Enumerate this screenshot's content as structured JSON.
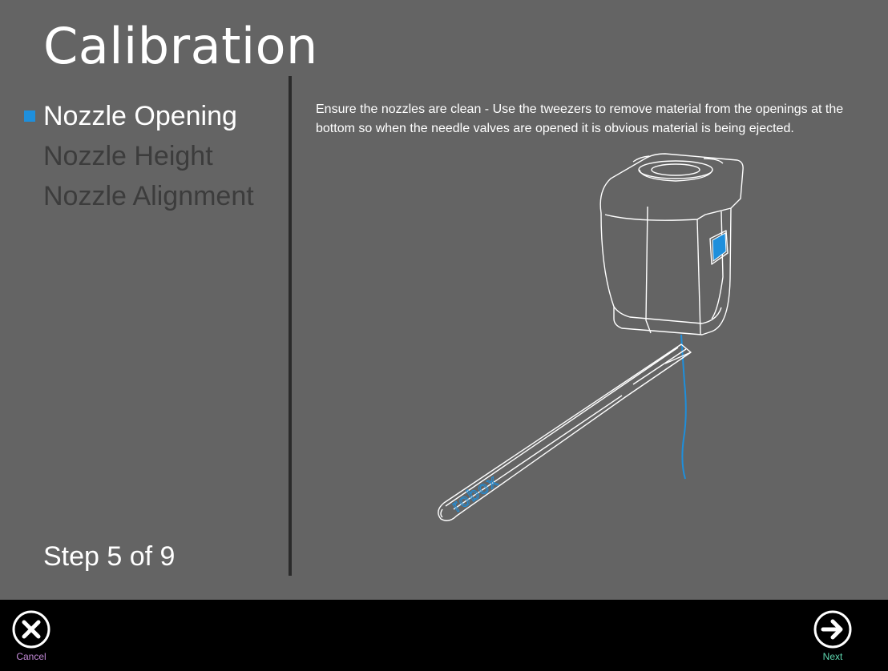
{
  "header": {
    "title": "Calibration"
  },
  "steps": [
    {
      "label": "Nozzle Opening",
      "active": true
    },
    {
      "label": "Nozzle Height",
      "active": false
    },
    {
      "label": "Nozzle Alignment",
      "active": false
    }
  ],
  "step_counter": "Step 5 of 9",
  "instructions": "Ensure the nozzles are clean - Use the tweezers to remove material from the openings at the bottom so when the needle valves are opened it is obvious material is being ejected.",
  "illustration": {
    "tweezers_brand": "robox",
    "icons": [
      "print-head-icon",
      "tweezers-icon",
      "filament-strand-icon"
    ]
  },
  "footer": {
    "cancel_label": "Cancel",
    "cancel_icon": "close-icon",
    "next_label": "Next",
    "next_icon": "arrow-right-icon"
  },
  "colors": {
    "background": "#646464",
    "accent": "#1e8fdc",
    "inactive_step": "#3c3c3c",
    "footer": "#000000"
  }
}
